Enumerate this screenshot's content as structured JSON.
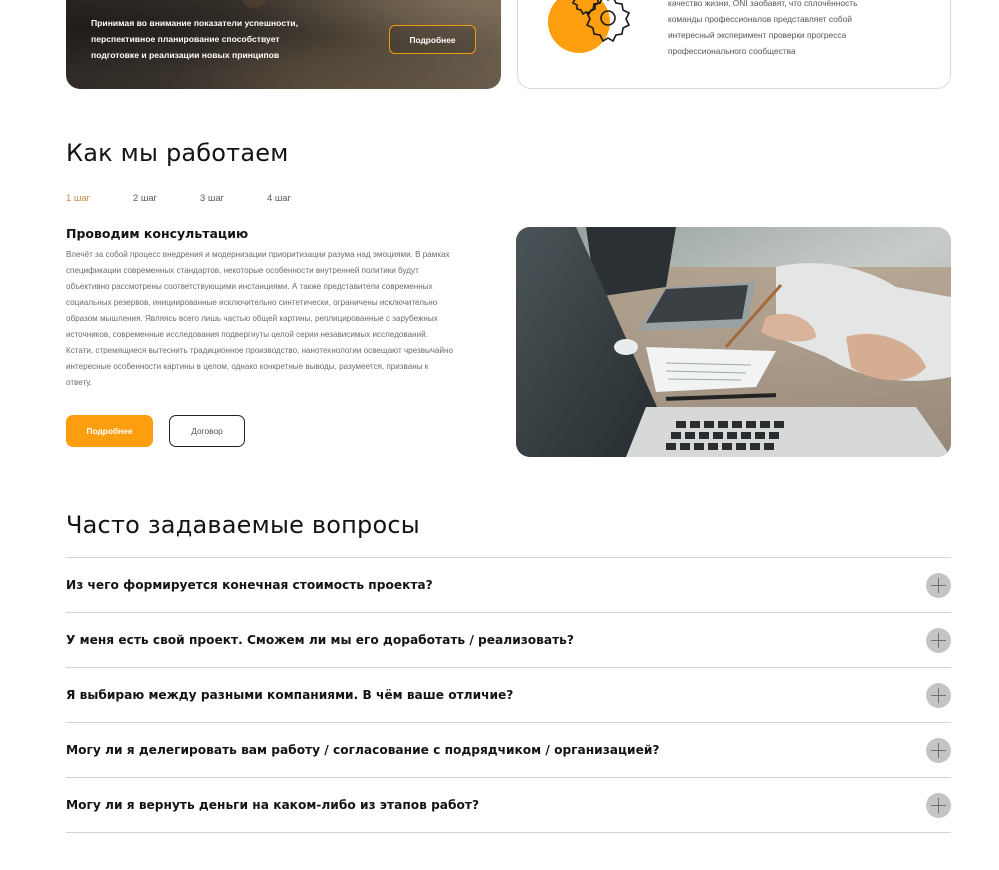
{
  "cards": {
    "dark": {
      "lines": [
        "Принимая во внимание показатели успешности,",
        "перспективное планирование способствует",
        "подготовке и реализации новых принципов"
      ],
      "button_label": "Подробнее"
    },
    "light": {
      "lines": [
        "качество жизни, ONI заобавят, что сплочённость",
        "команды профессионалов представляет собой",
        "интересный эксперимент проверки прогресса",
        "профессионального сообщества"
      ],
      "icon": "gears-icon"
    }
  },
  "how_we_work": {
    "title": "Как мы работаем",
    "steps": [
      "1 шаг",
      "2 шаг",
      "3 шаг",
      "4 шаг"
    ],
    "active_step": 0,
    "heading": "Проводим консультацию",
    "body": "Влечёт за собой процесс внедрения и модернизации приоритизации разума над эмоциями. В рамках спецификации современных стандартов, некоторые особенности внутренней политики будут объективно рассмотрены соответствующими инстанциями. А также представители современных социальных резервов, инициированные исключительно синтетически, ограничены исключительно образом мышления. Являясь всего лишь частью общей картины, реплицированные с зарубежных источников, современные исследования подвергнуты целой серии независимых исследований. Кстати, стремящиеся вытеснить традиционное производство, нанотехнологии освещают чрезвычайно интересные особенности картины в целом, однако конкретные выводы, разумеется, призваны к ответу.",
    "primary_button": "Подробнее",
    "secondary_button": "Договор",
    "photo": "laptops-desk-photo"
  },
  "faq": {
    "title": "Часто задаваемые вопросы",
    "items": [
      "Из чего формируется конечная стоимость проекта?",
      "У меня есть свой проект. Сможем ли мы его доработать / реализовать?",
      "Я выбираю между разными компаниями. В чём ваше отличие?",
      "Могу ли я делегировать вам работу / согласование с подрядчиком / организацией?",
      "Могу ли я вернуть деньги на каком-либо из этапов работ?"
    ],
    "expand_icon": "plus-icon"
  },
  "colors": {
    "accent": "#fc9e0e",
    "active_step": "#c98a4a",
    "divider": "#d2d2d2"
  }
}
